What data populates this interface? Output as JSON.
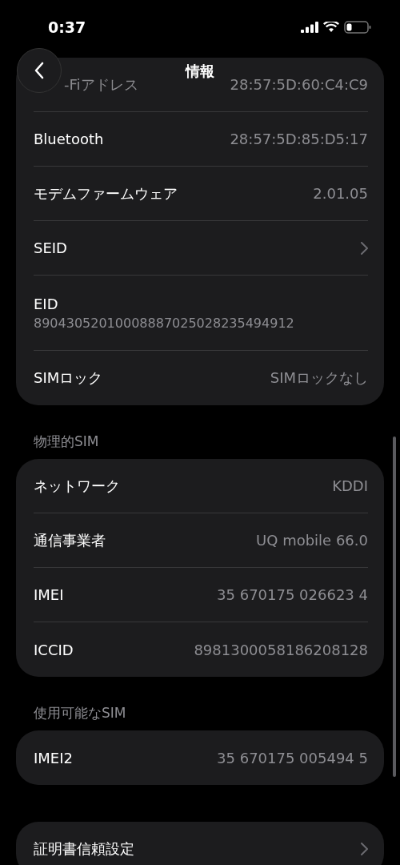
{
  "status_bar": {
    "time": "0:37"
  },
  "nav": {
    "title": "情報"
  },
  "groups": [
    {
      "rows": [
        {
          "kind": "obscured",
          "label": "-Fiアドレス",
          "value": "28:57:5D:60:C4:C9"
        },
        {
          "kind": "value",
          "label": "Bluetooth",
          "value": "28:57:5D:85:D5:17"
        },
        {
          "kind": "value",
          "label": "モデムファームウェア",
          "value": "2.01.05"
        },
        {
          "kind": "link",
          "label": "SEID"
        },
        {
          "kind": "stacked",
          "label": "EID",
          "value": "89043052010008887025028235494912"
        },
        {
          "kind": "value",
          "label": "SIMロック",
          "value": "SIMロックなし"
        }
      ]
    },
    {
      "header": "物理的SIM",
      "rows": [
        {
          "kind": "value",
          "label": "ネットワーク",
          "value": "KDDI"
        },
        {
          "kind": "value",
          "label": "通信事業者",
          "value": "UQ mobile 66.0"
        },
        {
          "kind": "value",
          "label": "IMEI",
          "value": "35 670175 026623 4"
        },
        {
          "kind": "value",
          "label": "ICCID",
          "value": "8981300058186208128"
        }
      ]
    },
    {
      "header": "使用可能なSIM",
      "rows": [
        {
          "kind": "value",
          "label": "IMEI2",
          "value": "35 670175 005494 5"
        }
      ]
    },
    {
      "rows": [
        {
          "kind": "link",
          "label": "証明書信頼設定"
        }
      ]
    }
  ]
}
